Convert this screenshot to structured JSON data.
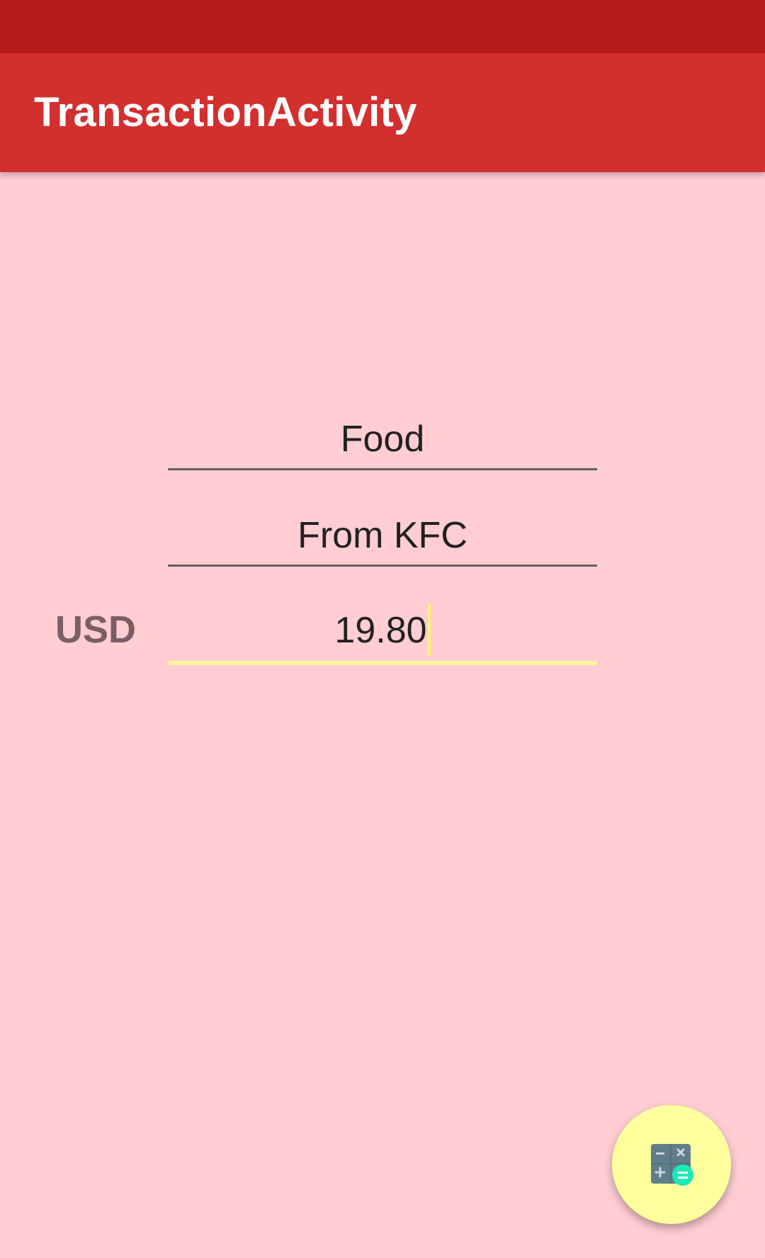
{
  "app_bar": {
    "title": "TransactionActivity",
    "color": "#D32F2F",
    "status_bar_color": "#B71C1C"
  },
  "form": {
    "category": {
      "value": "Food"
    },
    "description": {
      "value": "From KFC"
    },
    "amount": {
      "currency": "USD",
      "value": "19.80"
    }
  },
  "fab": {
    "icon": "calculator-icon",
    "color": "#FFFF9D"
  },
  "background_color": "#FFCDD2"
}
